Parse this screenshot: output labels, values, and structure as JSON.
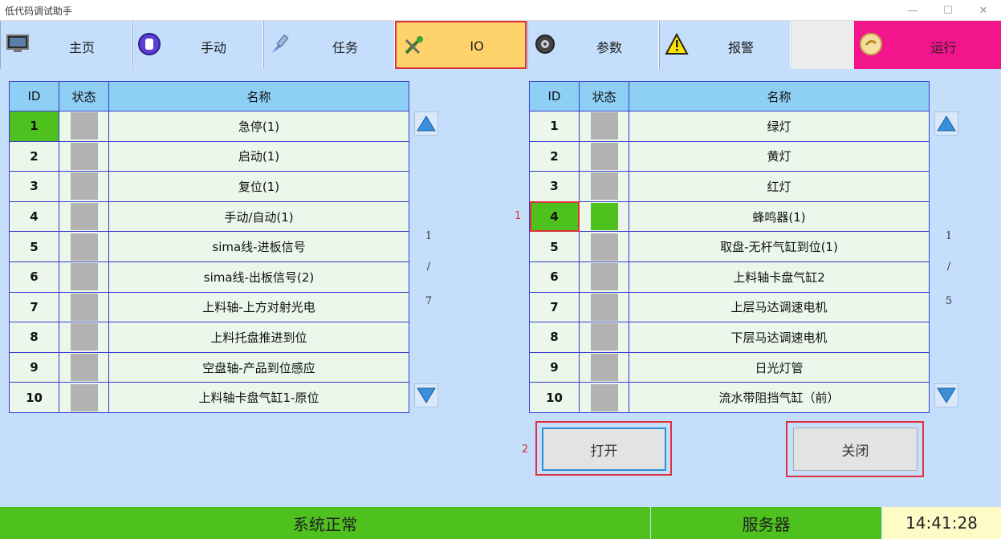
{
  "window": {
    "title": "低代码调试助手",
    "min_glyph": "—",
    "max_glyph": "☐",
    "close_glyph": "✕"
  },
  "toolbar": [
    {
      "label": "主页",
      "icon": "monitor-icon"
    },
    {
      "label": "手动",
      "icon": "hand-icon"
    },
    {
      "label": "任务",
      "icon": "brush-icon"
    },
    {
      "label": "IO",
      "icon": "wrench-icon",
      "active": true
    },
    {
      "label": "参数",
      "icon": "gear-icon"
    },
    {
      "label": "报警",
      "icon": "warning-icon"
    },
    {
      "label": "",
      "icon": ""
    },
    {
      "label": "运行",
      "icon": "run-icon"
    }
  ],
  "inputs_table": {
    "headers": {
      "id": "ID",
      "status": "状态",
      "name": "名称"
    },
    "rows": [
      {
        "id": "1",
        "name": "急停(1)",
        "id_on": true,
        "status_on": false
      },
      {
        "id": "2",
        "name": "启动(1)",
        "id_on": false,
        "status_on": false
      },
      {
        "id": "3",
        "name": "复位(1)",
        "id_on": false,
        "status_on": false
      },
      {
        "id": "4",
        "name": "手动/自动(1)",
        "id_on": false,
        "status_on": false
      },
      {
        "id": "5",
        "name": "sima线-进板信号",
        "id_on": false,
        "status_on": false
      },
      {
        "id": "6",
        "name": "sima线-出板信号(2)",
        "id_on": false,
        "status_on": false
      },
      {
        "id": "7",
        "name": "上料轴-上方对射光电",
        "id_on": false,
        "status_on": false
      },
      {
        "id": "8",
        "name": "上料托盘推进到位",
        "id_on": false,
        "status_on": false
      },
      {
        "id": "9",
        "name": "空盘轴-产品到位感应",
        "id_on": false,
        "status_on": false
      },
      {
        "id": "10",
        "name": "上料轴卡盘气缸1-原位",
        "id_on": false,
        "status_on": false
      }
    ],
    "pager": {
      "current": "1",
      "sep": "/",
      "total": "7"
    }
  },
  "outputs_table": {
    "headers": {
      "id": "ID",
      "status": "状态",
      "name": "名称"
    },
    "rows": [
      {
        "id": "1",
        "name": "绿灯",
        "id_on": false,
        "status_on": false
      },
      {
        "id": "2",
        "name": "黄灯",
        "id_on": false,
        "status_on": false
      },
      {
        "id": "3",
        "name": "红灯",
        "id_on": false,
        "status_on": false
      },
      {
        "id": "4",
        "name": "蜂鸣器(1)",
        "id_on": true,
        "status_on": true,
        "selected": true
      },
      {
        "id": "5",
        "name": "取盘-无杆气缸到位(1)",
        "id_on": false,
        "status_on": false
      },
      {
        "id": "6",
        "name": "上料轴卡盘气缸2",
        "id_on": false,
        "status_on": false
      },
      {
        "id": "7",
        "name": "上层马达调速电机",
        "id_on": false,
        "status_on": false
      },
      {
        "id": "8",
        "name": "下层马达调速电机",
        "id_on": false,
        "status_on": false
      },
      {
        "id": "9",
        "name": "日光灯管",
        "id_on": false,
        "status_on": false
      },
      {
        "id": "10",
        "name": "流水带阻挡气缸（前）",
        "id_on": false,
        "status_on": false
      }
    ],
    "pager": {
      "current": "1",
      "sep": "/",
      "total": "5"
    }
  },
  "markers": {
    "one": "1",
    "two": "2"
  },
  "actions": {
    "open": "打开",
    "close": "关闭"
  },
  "status_bar": {
    "system": "系统正常",
    "server": "服务器",
    "time": "14:41:28"
  },
  "colors": {
    "on": "#4ec11f",
    "off": "#b2b2b2",
    "header": "#8ecff5",
    "active_tab": "#ffd36b",
    "run": "#f3158b",
    "highlight": "#e0313a"
  }
}
